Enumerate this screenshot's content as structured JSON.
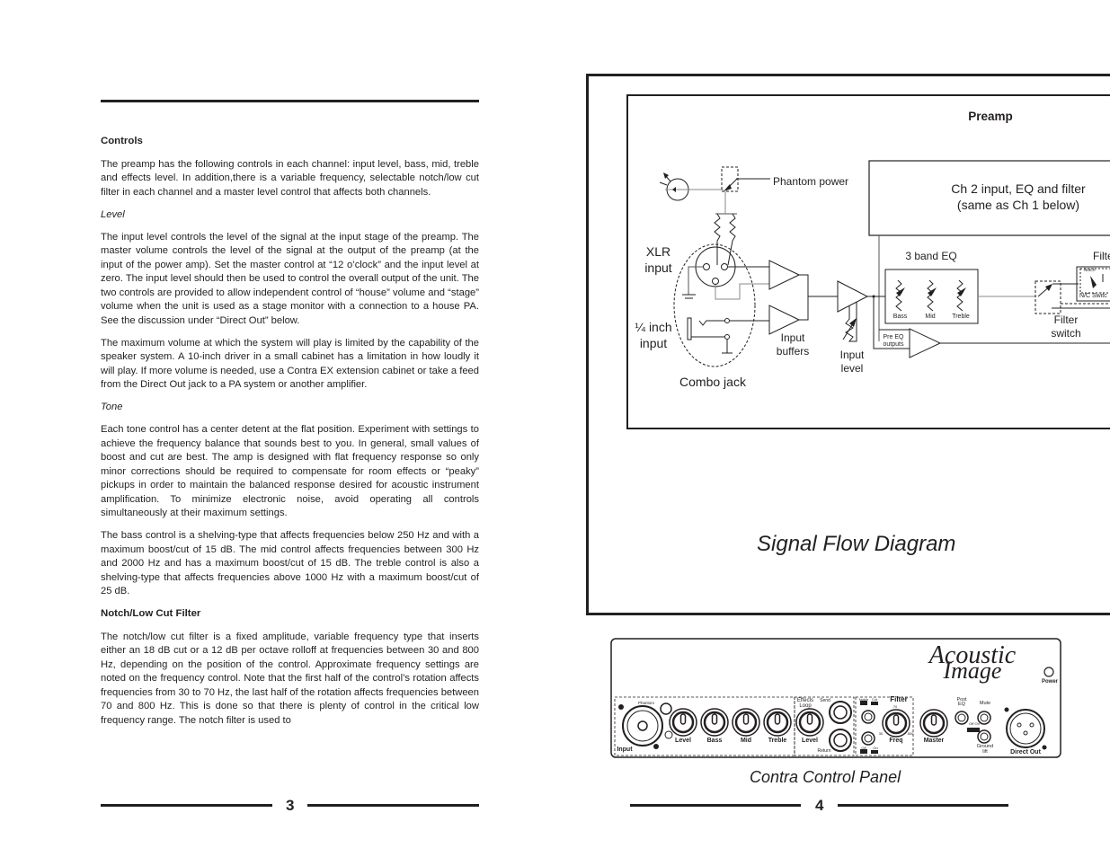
{
  "left_page": {
    "page_number": "3",
    "sections": [
      {
        "type": "heading",
        "text": "Controls"
      },
      {
        "type": "para",
        "text": "The preamp has the following controls in each channel: input level, bass, mid, treble and effects level.  In addition,there is a variable frequency, selectable notch/low cut  filter in each channel and  a master level control that affects both channels."
      },
      {
        "type": "subheading",
        "text": "Level"
      },
      {
        "type": "para",
        "text": "The input level controls the level of the signal at the input stage of the preamp. The master volume controls the level of the signal at the output of the preamp (at the input of the power amp).  Set the master control at “12 o’clock” and the input level at zero.  The input level should then be used to control the overall output of the unit. The two controls are provided to allow independent control of “house” volume and “stage” volume when the unit is used as a stage monitor with a connection to a house PA. See the discussion under “Direct Out” below."
      },
      {
        "type": "para",
        "text": "The maximum volume at which the system will play is limited by the capability of the speaker system.  A 10-inch driver in a small cabinet has a limitation in how loudly it will play. If more volume is needed, use a Contra EX extension cabinet or take a feed from the Direct Out jack to a PA system or another amplifier."
      },
      {
        "type": "subheading",
        "text": "Tone"
      },
      {
        "type": "para",
        "text": "Each tone control has a center detent at the flat position.  Experiment with settings to achieve the frequency balance that sounds best to you.  In general, small values of boost and cut are best.  The amp is designed with flat frequency response so only minor corrections should be required to compensate for room effects or “peaky” pickups in order to maintain the balanced response desired for acoustic instrument amplification. To minimize electronic noise, avoid operating all controls simultaneously at their maximum settings."
      },
      {
        "type": "para",
        "text": "The bass control is a shelving-type that affects frequencies below 250 Hz and with a maximum boost/cut of 15 dB.  The mid control affects frequencies between 300 Hz and 2000 Hz and has a maximum boost/cut of 15 dB.  The treble control is also a shelving-type that affects frequencies above 1000 Hz with a maximum boost/cut of 25 dB."
      },
      {
        "type": "heading",
        "text": "Notch/Low Cut Filter"
      },
      {
        "type": "para",
        "text": "The notch/low cut filter is a fixed amplitude, variable frequency type that inserts either an 18 dB cut or a 12 dB per octave rolloff at frequencies  between 30 and 800 Hz, depending on the position of the control. Approximate frequency settings are noted on the frequency control. Note that the first half of the control’s rotation affects frequencies from 30 to 70 Hz, the last half of the rotation affects frequencies between 70 and 800 Hz. This is done so that there is plenty of control in the critical low frequency range. The notch filter is used to"
      }
    ]
  },
  "right_page": {
    "page_number": "4",
    "diagram": {
      "title": "Signal Flow Diagram",
      "preamp_label": "Preamp",
      "ch2_box_line1": "Ch 2 input, EQ and filter",
      "ch2_box_line2": "(same as Ch 1 below)",
      "phantom_power": "Phantom power",
      "xlr_input_1": "XLR",
      "xlr_input_2": "input",
      "quarter_inch_1": "¼ inch",
      "quarter_inch_2": "input",
      "combo_jack": "Combo jack",
      "input_buffers_1": "Input",
      "input_buffers_2": "buffers",
      "input_level_1": "Input",
      "input_level_2": "level",
      "eq_label": "3 band EQ",
      "eq_bands": [
        "Bass",
        "Mid",
        "Treble"
      ],
      "pre_eq_1": "Pre EQ",
      "pre_eq_2": "outputs",
      "filter_partial": "Filte",
      "filter_switch_1": "Filter",
      "filter_switch_2": "switch",
      "notch_label": "Notch",
      "cut_label": "Cut",
      "nc_switch": "N/C Switc"
    },
    "panel": {
      "caption": "Contra Control Panel",
      "brand_1": "Acoustic",
      "brand_2": "Image",
      "power": "Power",
      "phantom": "Phantom",
      "input": "Input",
      "knobs": [
        "Level",
        "Bass",
        "Mid",
        "Treble"
      ],
      "effects_loop_1": "Effects",
      "effects_loop_2": "Loop",
      "effects_level": "Level",
      "send": "Send",
      "return": "Return",
      "notch": "Notch",
      "cut": "Cut",
      "off": "Off",
      "on": "On",
      "filter": "Filter",
      "freq": "Freq",
      "freq_min": "30",
      "freq_mid": "70",
      "freq_max": "800",
      "master": "Master",
      "post_eq_1": "Post",
      "post_eq_2": "EQ",
      "mute": "Mute",
      "off_on": "Off On",
      "ground_lift_1": "Ground",
      "ground_lift_2": "lift",
      "direct_out": "Direct Out"
    }
  }
}
